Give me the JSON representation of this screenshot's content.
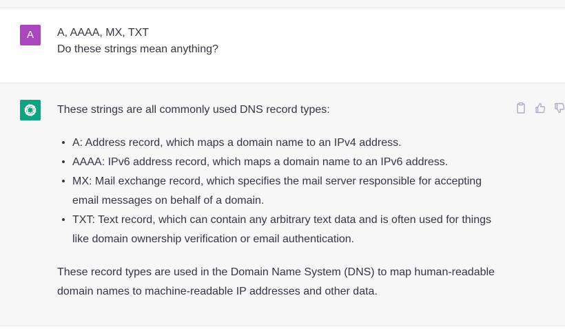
{
  "user_message": {
    "avatar_letter": "A",
    "lines": [
      "A, AAAA, MX, TXT",
      "Do these strings mean anything?"
    ]
  },
  "assistant_message": {
    "intro": "These strings are all commonly used DNS record types:",
    "records": [
      "A: Address record, which maps a domain name to an IPv4 address.",
      "AAAA: IPv6 address record, which maps a domain name to an IPv6 address.",
      "MX: Mail exchange record, which specifies the mail server responsible for accepting email messages on behalf of a domain.",
      "TXT: Text record, which can contain any arbitrary text data and is often used for things like domain ownership verification or email authentication."
    ],
    "outro": "These record types are used in the Domain Name System (DNS) to map human-readable domain names to machine-readable IP addresses and other data."
  },
  "icons": {
    "assistant_avatar": "openai-logo-icon",
    "copy": "clipboard-icon",
    "like": "thumbs-up-icon",
    "dislike": "thumbs-down-icon"
  },
  "colors": {
    "user_avatar": "#ab47bc",
    "assistant_avatar": "#10a37f",
    "assistant_background": "#f7f7f8",
    "text": "#343541",
    "action_icon": "#acacbe"
  }
}
